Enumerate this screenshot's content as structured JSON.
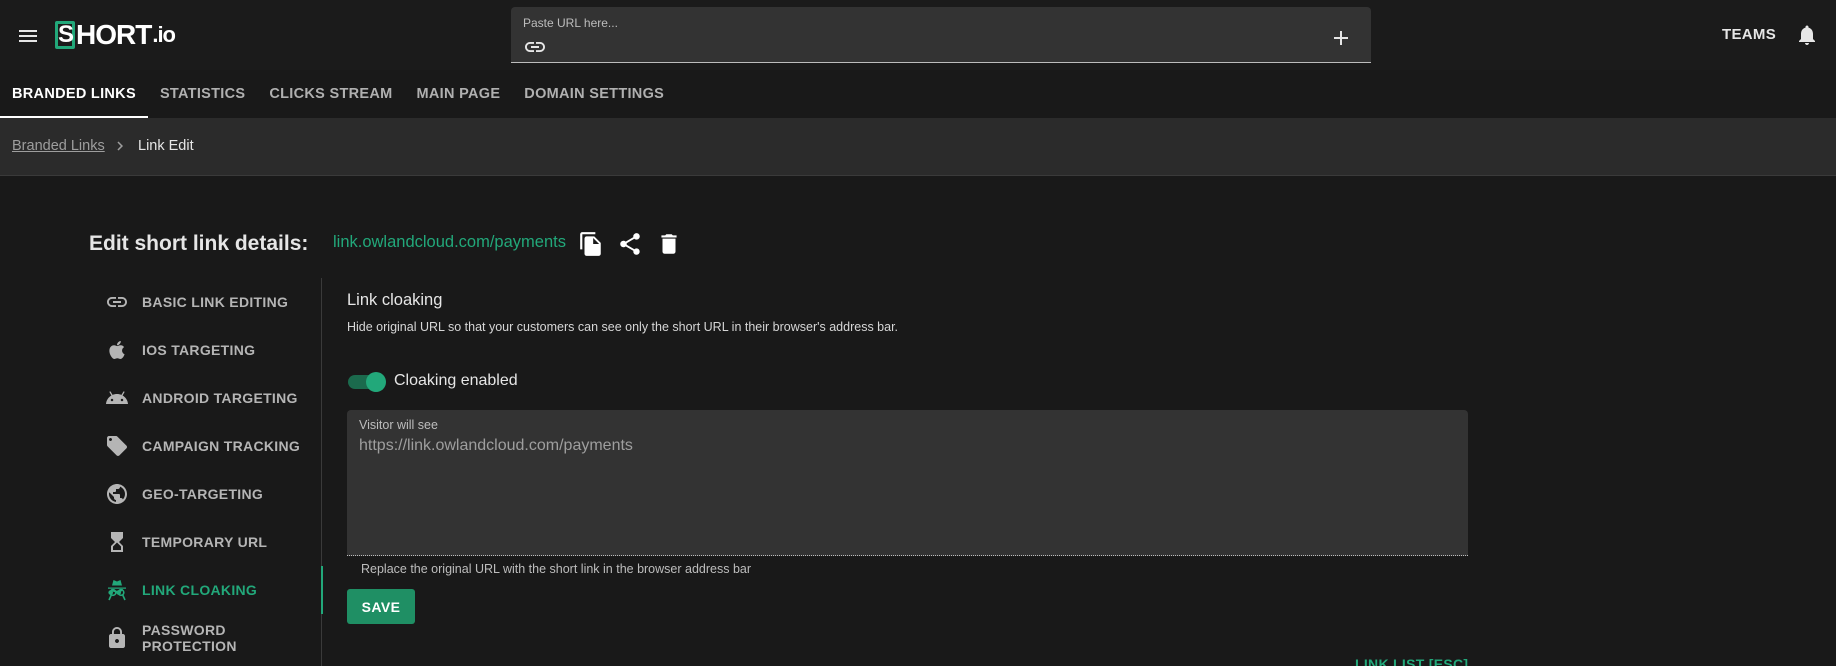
{
  "app": {
    "logo_text": "SHORT.io",
    "accent_color": "#22a87a"
  },
  "header": {
    "menu_icon": "menu-icon",
    "url_label": "Paste URL here...",
    "link_icon": "link-icon",
    "add_icon": "plus-icon",
    "teams_label": "TEAMS",
    "bell_icon": "bell-icon"
  },
  "tabs": [
    {
      "label": "BRANDED LINKS",
      "active": true
    },
    {
      "label": "STATISTICS",
      "active": false
    },
    {
      "label": "CLICKS STREAM",
      "active": false
    },
    {
      "label": "MAIN PAGE",
      "active": false
    },
    {
      "label": "DOMAIN SETTINGS",
      "active": false
    }
  ],
  "breadcrumb": {
    "parent": "Branded Links",
    "current": "Link Edit"
  },
  "edit": {
    "title": "Edit short link details:",
    "short_url": "link.owlandcloud.com/payments",
    "actions": [
      "copy-icon",
      "share-icon",
      "delete-icon"
    ]
  },
  "side_menu": [
    {
      "label": "BASIC LINK EDITING",
      "icon": "link-icon",
      "active": false
    },
    {
      "label": "IOS TARGETING",
      "icon": "apple-icon",
      "active": false
    },
    {
      "label": "ANDROID TARGETING",
      "icon": "android-icon",
      "active": false
    },
    {
      "label": "CAMPAIGN TRACKING",
      "icon": "tag-icon",
      "active": false
    },
    {
      "label": "GEO-TARGETING",
      "icon": "globe-icon",
      "active": false
    },
    {
      "label": "TEMPORARY URL",
      "icon": "hourglass-icon",
      "active": false
    },
    {
      "label": "LINK CLOAKING",
      "icon": "spy-icon",
      "active": true
    },
    {
      "label": "PASSWORD PROTECTION",
      "icon": "lock-icon",
      "active": false
    }
  ],
  "panel": {
    "title": "Link cloaking",
    "description": "Hide original URL so that your customers can see only the short URL in their browser's address bar.",
    "toggle_label": "Cloaking enabled",
    "toggle_on": true,
    "visitor_label": "Visitor will see",
    "visitor_value": "https://link.owlandcloud.com/payments",
    "helper_text": "Replace the original URL with the short link in the browser address bar",
    "save_label": "SAVE",
    "link_list_label": "LINK LIST [ESC]"
  }
}
